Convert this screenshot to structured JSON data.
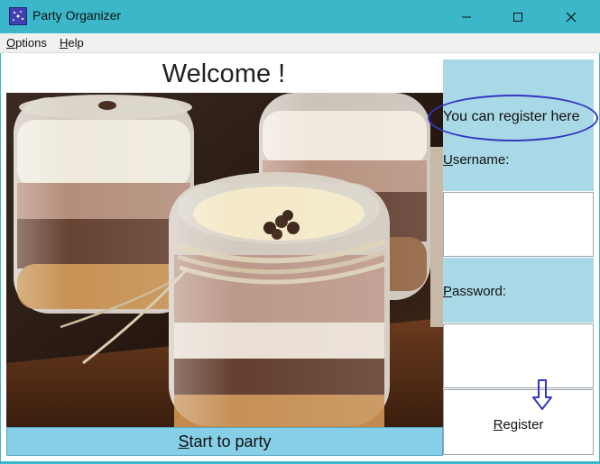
{
  "window": {
    "title": "Party Organizer",
    "icon": "app-icon",
    "controls": {
      "minimize": "─",
      "maximize": "☐",
      "close": "✕"
    }
  },
  "menu": {
    "options": {
      "accel": "O",
      "rest": "ptions"
    },
    "help": {
      "accel": "H",
      "rest": "elp"
    }
  },
  "main": {
    "welcome": "Welcome !",
    "image": "dessert-jars-photo",
    "start_button": {
      "accel": "S",
      "rest": "tart to party"
    }
  },
  "register_panel": {
    "hint": "You can register here",
    "username_label": {
      "accel": "U",
      "rest": "sername:"
    },
    "username_value": "",
    "password_label": {
      "accel": "P",
      "rest": "assword:"
    },
    "password_value": "",
    "register_button": {
      "accel": "R",
      "rest": "egister"
    },
    "annotation_color": "#3535c0"
  },
  "colors": {
    "titlebar": "#3cb7c9",
    "panel": "#a9d8e6",
    "start_button": "#87cfe6"
  }
}
